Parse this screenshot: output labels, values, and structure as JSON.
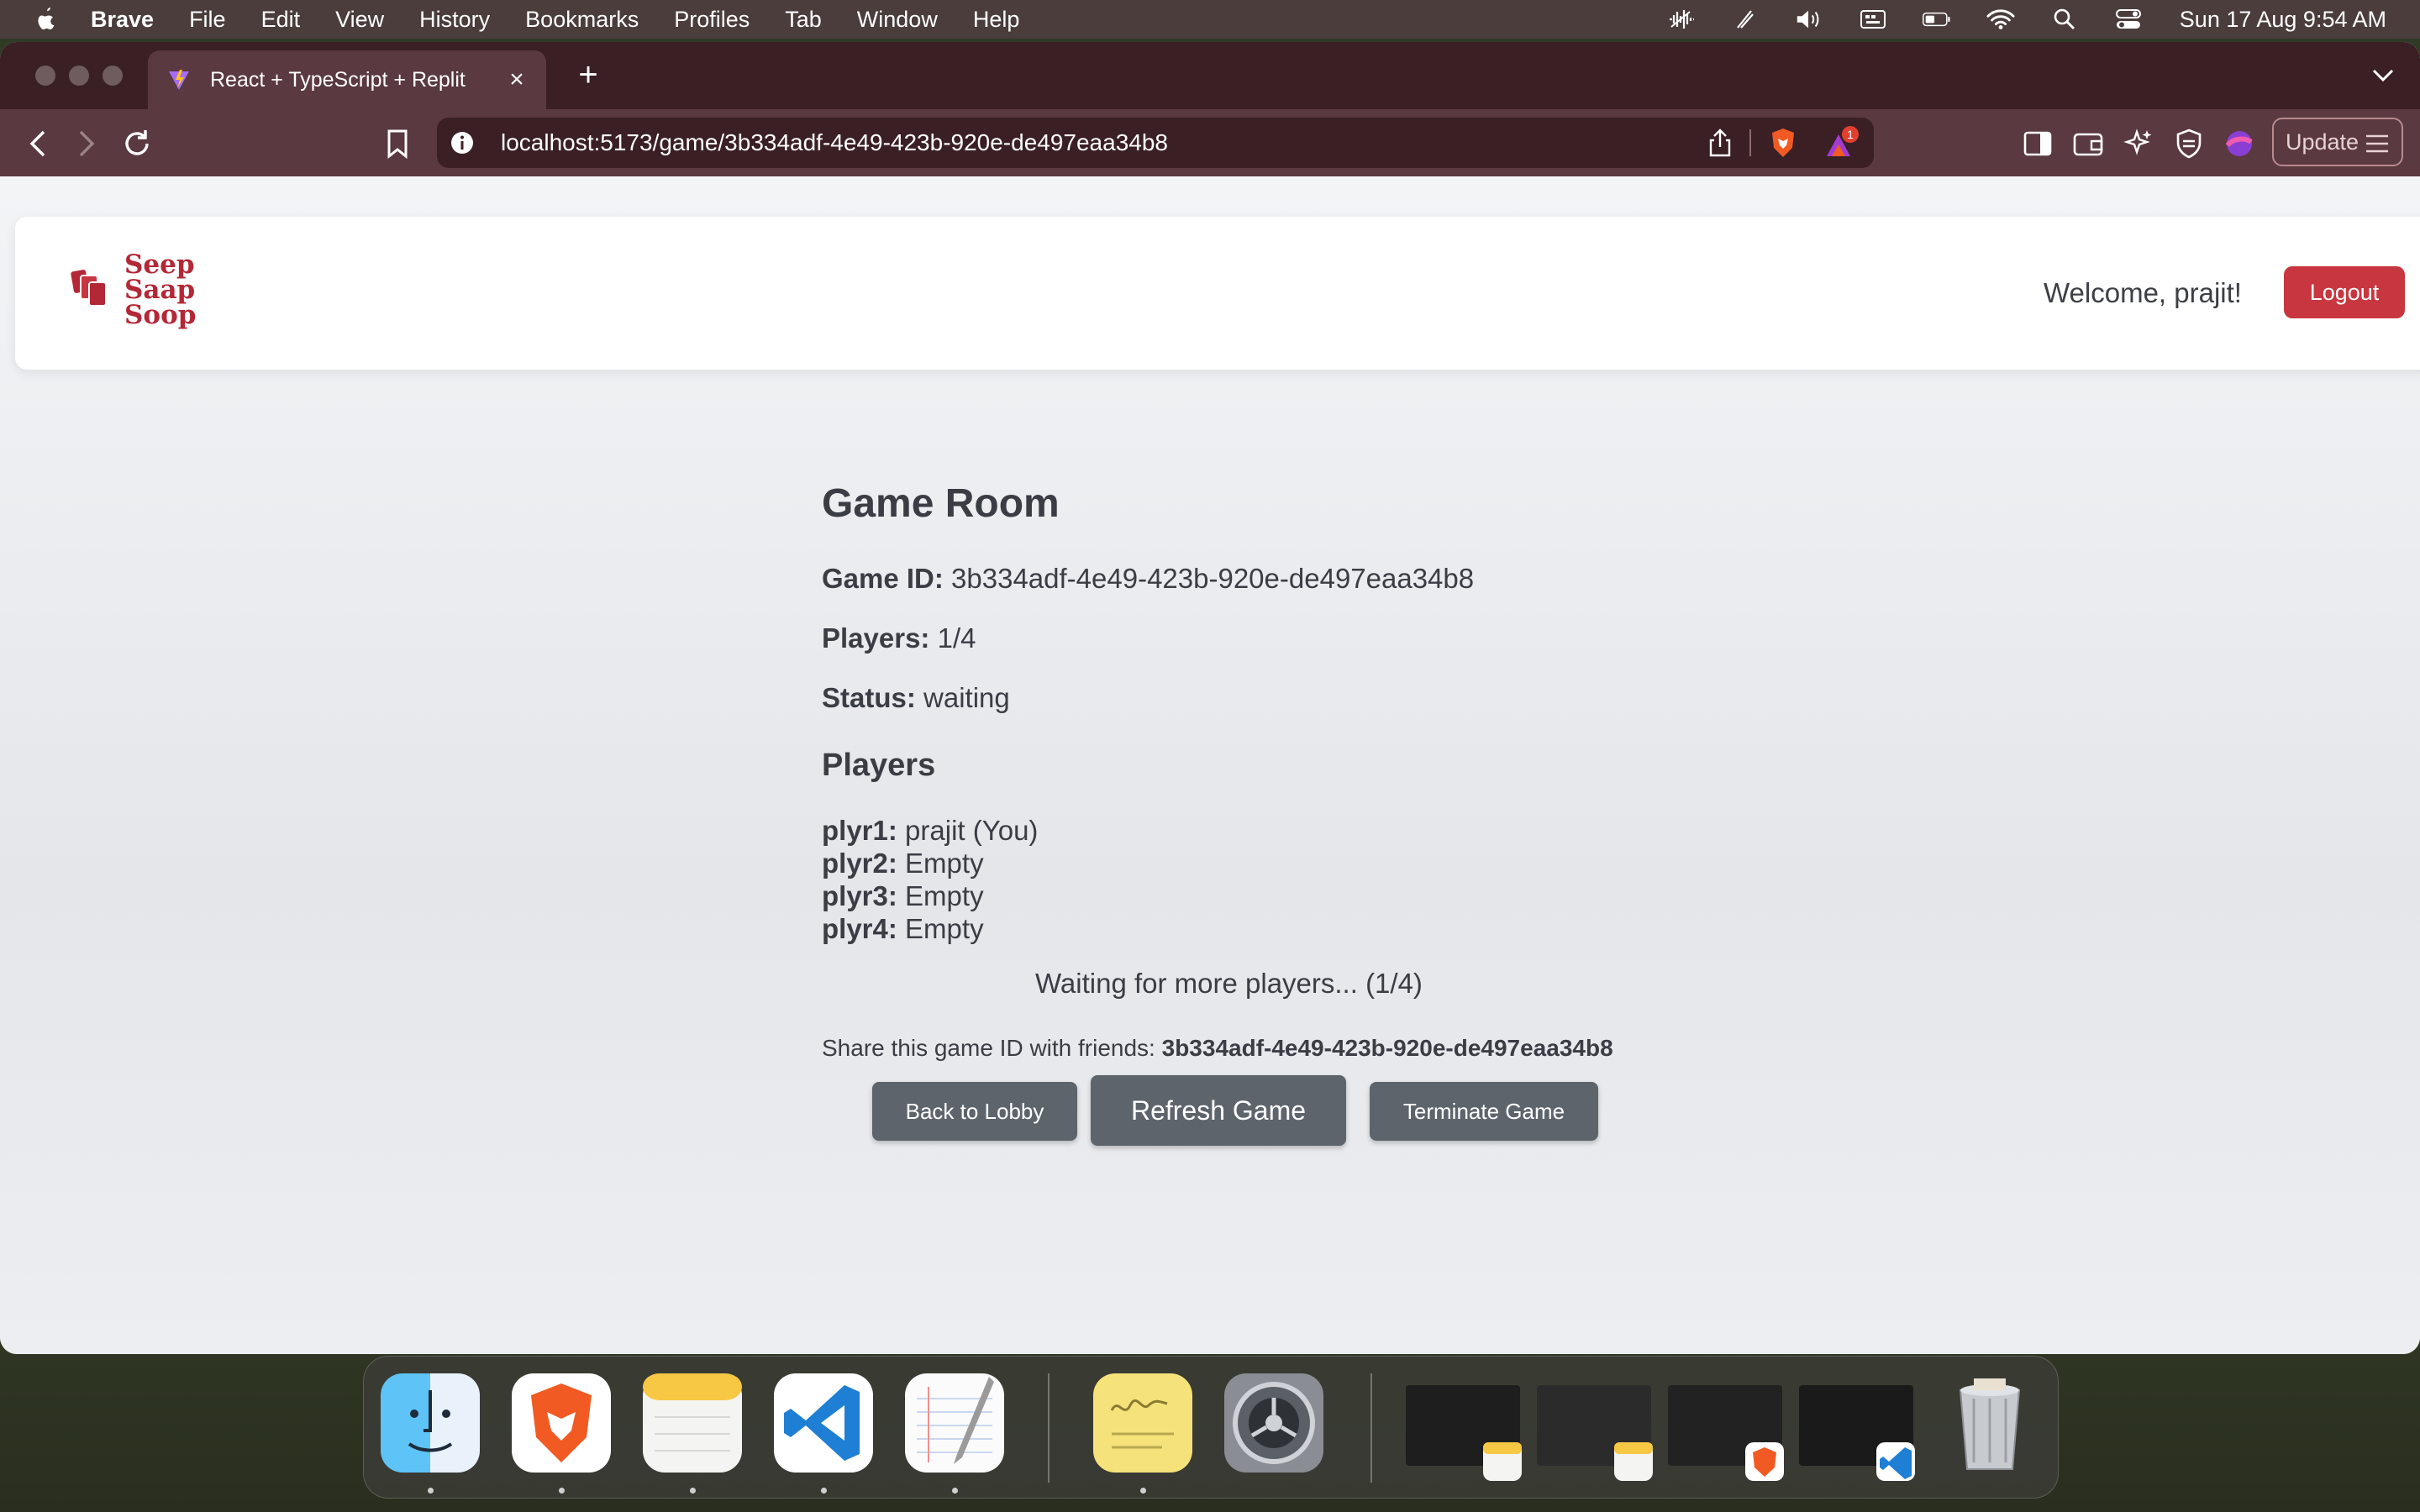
{
  "menubar": {
    "app": "Brave",
    "items": [
      "File",
      "Edit",
      "View",
      "History",
      "Bookmarks",
      "Profiles",
      "Tab",
      "Window",
      "Help"
    ],
    "clock": "Sun 17 Aug  9:54 AM"
  },
  "browser": {
    "tab_title": "React + TypeScript + Replit",
    "url": "localhost:5173/game/3b334adf-4e49-423b-920e-de497eaa34b8",
    "rewards_badge": "1",
    "update_label": "Update"
  },
  "header": {
    "logo_line1": "Seep",
    "logo_line2": "Saap",
    "logo_line3": "Soop",
    "welcome": "Welcome, prajit!",
    "logout_label": "Logout"
  },
  "game": {
    "title": "Game Room",
    "game_id_label": "Game ID:",
    "game_id": "3b334adf-4e49-423b-920e-de497eaa34b8",
    "players_label": "Players:",
    "players_count": "1/4",
    "status_label": "Status:",
    "status": "waiting",
    "players_heading": "Players",
    "players": [
      {
        "slot": "plyr1:",
        "name": "prajit (You)"
      },
      {
        "slot": "plyr2:",
        "name": "Empty"
      },
      {
        "slot": "plyr3:",
        "name": "Empty"
      },
      {
        "slot": "plyr4:",
        "name": "Empty"
      }
    ],
    "waiting_text": "Waiting for more players... (1/4)",
    "share_text": "Share this game ID with friends:",
    "share_id": "3b334adf-4e49-423b-920e-de497eaa34b8",
    "back_label": "Back to Lobby",
    "refresh_label": "Refresh Game",
    "terminate_label": "Terminate Game"
  },
  "colors": {
    "accent_red": "#c8363f",
    "logo_red": "#b32736",
    "button_gray": "#5e646c",
    "browser_chrome": "#5a3940"
  },
  "dock": {
    "apps": [
      "finder-icon",
      "brave-icon",
      "notes-icon",
      "vscode-icon",
      "textedit-icon",
      "stickies-icon",
      "system-settings-icon",
      "trash-icon"
    ]
  }
}
